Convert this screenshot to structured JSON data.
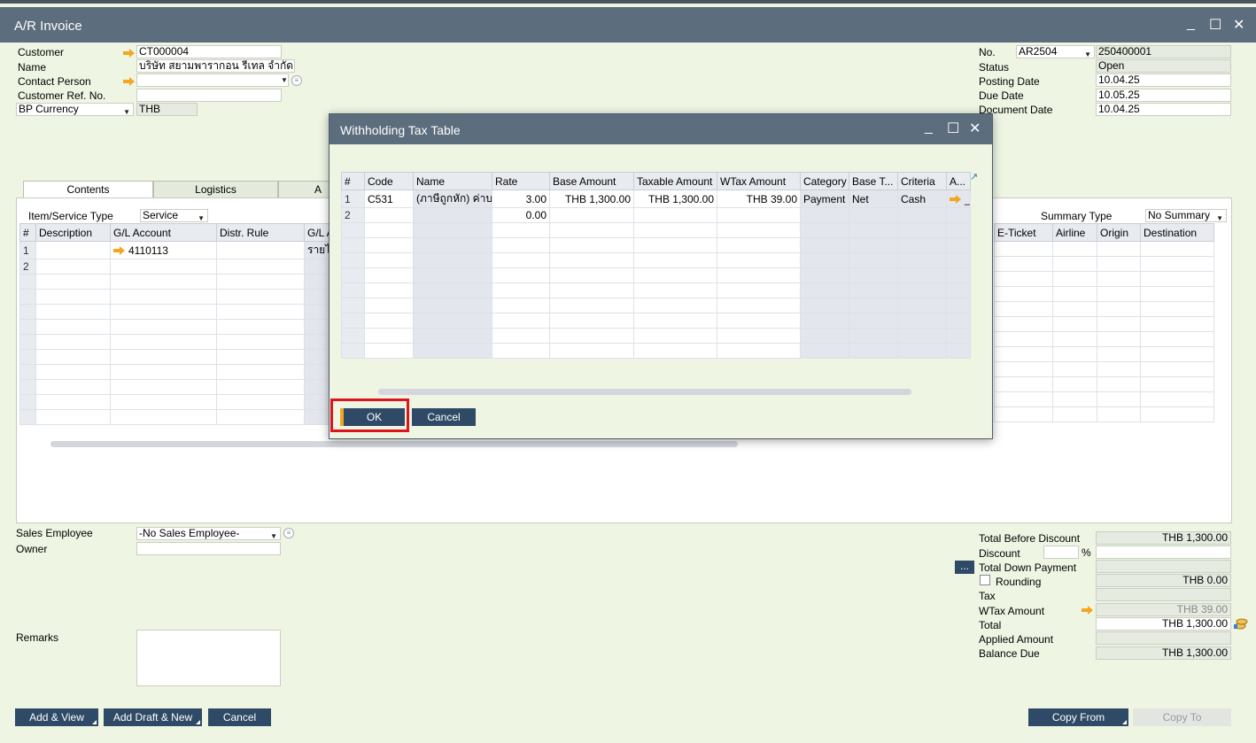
{
  "window": {
    "title": "A/R Invoice",
    "min": "_",
    "max": "☐",
    "close": "✕"
  },
  "header_left": {
    "customer_label": "Customer",
    "customer_value": "CT000004",
    "name_label": "Name",
    "name_value": "บริษัท สยามพารากอน รีเทล จำกัด",
    "contact_label": "Contact Person",
    "contact_value": "",
    "ref_label": "Customer Ref. No.",
    "ref_value": "",
    "currency_select": "BP Currency",
    "currency_value": "THB"
  },
  "header_right": {
    "no_label": "No.",
    "series": "AR2504",
    "doc_no": "250400001",
    "status_label": "Status",
    "status_value": "Open",
    "posting_label": "Posting Date",
    "posting_value": "10.04.25",
    "due_label": "Due Date",
    "due_value": "10.05.25",
    "docdate_label": "Document Date",
    "docdate_value": "10.04.25"
  },
  "tabs": [
    "Contents",
    "Logistics",
    "A"
  ],
  "contents": {
    "item_type_label": "Item/Service Type",
    "item_type_value": "Service",
    "summary_label": "Summary Type",
    "summary_value": "No Summary",
    "columns_left": [
      "#",
      "Description",
      "G/L Account",
      "Distr. Rule",
      "G/L A"
    ],
    "columns_right": [
      "E-Ticket",
      "Airline",
      "Origin",
      "Destination"
    ],
    "rows": [
      {
        "no": "1",
        "gl": "4110113",
        "gl_name": "รายไ"
      },
      {
        "no": "2",
        "gl": "",
        "gl_name": ""
      }
    ]
  },
  "dialog": {
    "title": "Withholding Tax Table",
    "min": "_",
    "max": "☐",
    "close": "✕",
    "columns": [
      "#",
      "Code",
      "Name",
      "Rate",
      "Base Amount",
      "Taxable Amount",
      "WTax Amount",
      "Category",
      "Base T...",
      "Criteria",
      "A..."
    ],
    "rows": [
      {
        "no": "1",
        "code": "C531",
        "name": "(ภาษีถูกหัก) ค่าบริ",
        "rate": "3.00",
        "base": "THB 1,300.00",
        "taxable": "THB 1,300.00",
        "wtax": "THB 39.00",
        "category": "Payment",
        "base_type": "Net",
        "criteria": "Cash",
        "a": "_"
      },
      {
        "no": "2",
        "code": "",
        "name": "",
        "rate": "0.00",
        "base": "",
        "taxable": "",
        "wtax": "",
        "category": "",
        "base_type": "",
        "criteria": "",
        "a": ""
      }
    ],
    "ok": "OK",
    "cancel": "Cancel"
  },
  "footer_left": {
    "sales_emp_label": "Sales Employee",
    "sales_emp_value": "-No Sales Employee-",
    "owner_label": "Owner",
    "owner_value": "",
    "remarks_label": "Remarks"
  },
  "totals": {
    "before_discount_label": "Total Before Discount",
    "before_discount_value": "THB 1,300.00",
    "discount_label": "Discount",
    "discount_pct": "%",
    "down_payment_label": "Total Down Payment",
    "down_payment_btn": "...",
    "rounding_label": "Rounding",
    "rounding_value": "THB 0.00",
    "tax_label": "Tax",
    "tax_value": "",
    "wtax_label": "WTax Amount",
    "wtax_value": "THB 39.00",
    "total_label": "Total",
    "total_value": "THB 1,300.00",
    "applied_label": "Applied Amount",
    "applied_value": "",
    "balance_label": "Balance Due",
    "balance_value": "THB 1,300.00"
  },
  "buttons": {
    "add_view": "Add & View",
    "add_draft": "Add Draft & New",
    "cancel": "Cancel",
    "copy_from": "Copy From",
    "copy_to": "Copy To"
  },
  "colors": {
    "titlebar": "#5c6d7d",
    "form_bg": "#eef5e3",
    "button": "#2e4a66",
    "highlight": "#e0131c",
    "arrow": "#f4a623"
  }
}
